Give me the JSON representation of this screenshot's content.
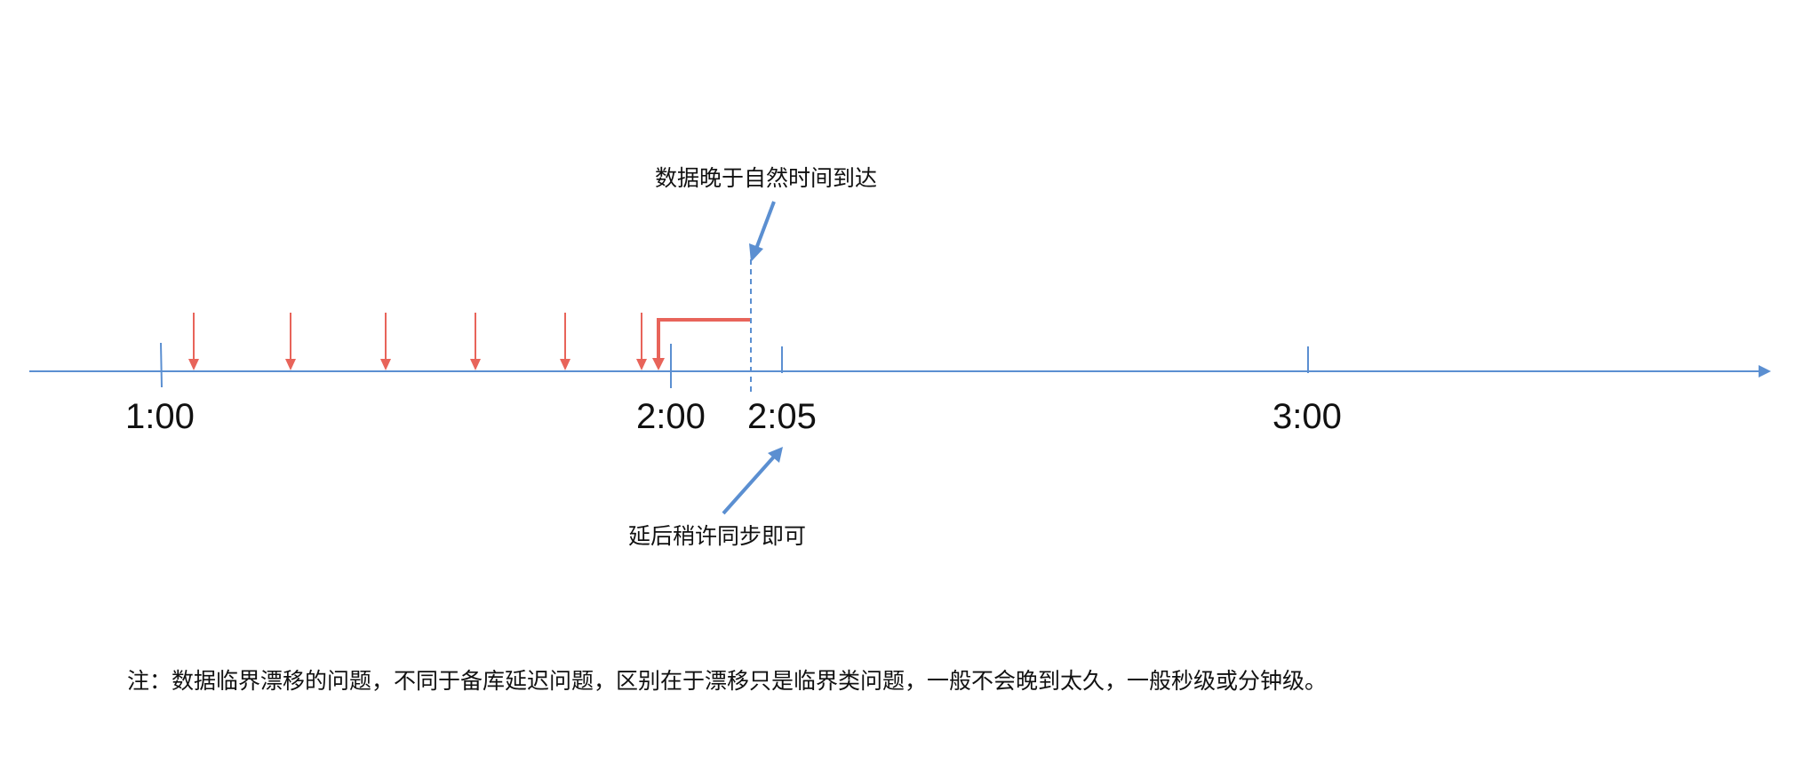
{
  "timeline": {
    "ticks": [
      {
        "label": "1:00"
      },
      {
        "label": "2:00"
      },
      {
        "label": "2:05"
      },
      {
        "label": "3:00"
      }
    ]
  },
  "annotations": {
    "late_arrival": "数据晚于自然时间到达",
    "delay_sync": "延后稍许同步即可"
  },
  "note": "注：数据临界漂移的问题，不同于备库延迟问题，区别在于漂移只是临界类问题，一般不会晚到太久，一般秒级或分钟级。",
  "colors": {
    "axis": "#5b8fd1",
    "event_arrow": "#e8645a",
    "drift_bracket": "#e8645a",
    "pointer_arrow": "#5b8fd1",
    "text": "#111111"
  }
}
